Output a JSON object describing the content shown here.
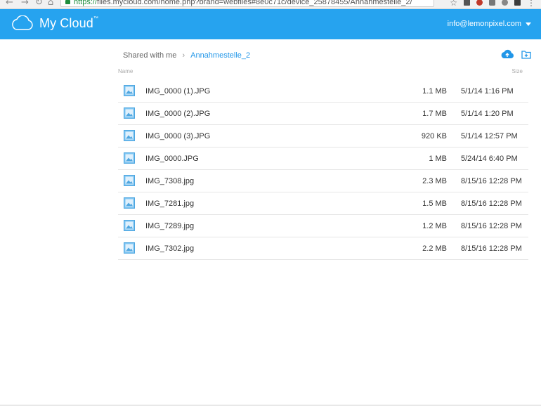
{
  "browser": {
    "back": "←",
    "forward": "→",
    "reload": "↻",
    "home": "⌂",
    "url_scheme": "https://",
    "url_host": "files.mycloud.com",
    "url_path": "/home.php?brand=webfiles#8e0c71c/device_25878455/Annahmestelle_2/",
    "icons": [
      "star-icon",
      "extension-icon",
      "extension-icon",
      "extension-icon",
      "extension-icon",
      "extension-icon",
      "menu-icon"
    ]
  },
  "header": {
    "brand": "My Cloud",
    "brand_mark": "™",
    "account_email": "info@lemonpixel.com",
    "colors": {
      "bar": "#26a3ef",
      "text": "#ffffff"
    }
  },
  "breadcrumb": {
    "root": "Shared with me",
    "separator": "›",
    "current": "Annahmestelle_2"
  },
  "toolbar": {
    "upload_icon": "cloud-upload-icon",
    "new_folder_icon": "new-folder-icon"
  },
  "columns": {
    "name": "Name",
    "size": "Size"
  },
  "files": [
    {
      "name": "IMG_0000 (1).JPG",
      "size": "1.1 MB",
      "date": "5/1/14 1:16 PM"
    },
    {
      "name": "IMG_0000 (2).JPG",
      "size": "1.7 MB",
      "date": "5/1/14 1:20 PM"
    },
    {
      "name": "IMG_0000 (3).JPG",
      "size": "920 KB",
      "date": "5/1/14 12:57 PM"
    },
    {
      "name": "IMG_0000.JPG",
      "size": "1 MB",
      "date": "5/24/14 6:40 PM"
    },
    {
      "name": "IMG_7308.jpg",
      "size": "2.3 MB",
      "date": "8/15/16 12:28 PM"
    },
    {
      "name": "IMG_7281.jpg",
      "size": "1.5 MB",
      "date": "8/15/16 12:28 PM"
    },
    {
      "name": "IMG_7289.jpg",
      "size": "1.2 MB",
      "date": "8/15/16 12:28 PM"
    },
    {
      "name": "IMG_7302.jpg",
      "size": "2.2 MB",
      "date": "8/15/16 12:28 PM"
    }
  ]
}
